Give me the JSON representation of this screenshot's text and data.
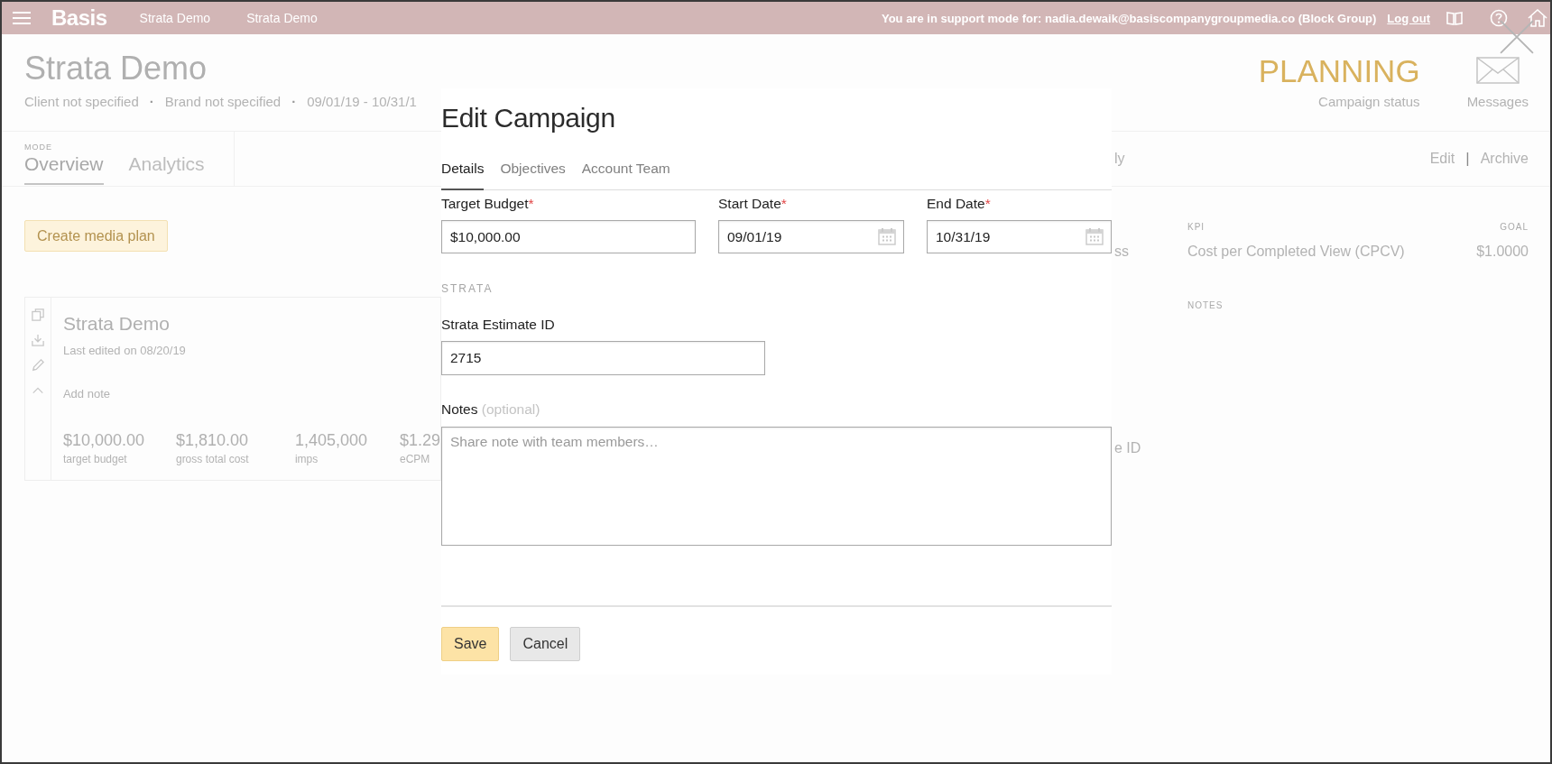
{
  "top_bar": {
    "logo": "Basis",
    "breadcrumbs": [
      "Strata Demo",
      "Strata Demo"
    ],
    "support_notice": "You are in support mode for: nadia.dewaik@basiscompanygroupmedia.co (Block Group)",
    "logout": "Log out"
  },
  "header": {
    "title": "Strata Demo",
    "meta": [
      {
        "kind": "text",
        "text": "Client not specified"
      },
      {
        "kind": "separator",
        "text": "·"
      },
      {
        "kind": "text",
        "text": "Brand not specified"
      },
      {
        "kind": "separator",
        "text": "·"
      },
      {
        "kind": "text",
        "text": "09/01/19 - 10/31/1"
      }
    ],
    "status": {
      "value": "PLANNING",
      "label": "Campaign status"
    },
    "messages": {
      "label": "Messages"
    }
  },
  "tab_bar": {
    "mode_label": "MODE",
    "tabs": [
      {
        "label": "Overview",
        "selected": true
      },
      {
        "label": "Analytics",
        "selected": false
      }
    ],
    "cut_text": "ly",
    "actions": [
      {
        "kind": "link",
        "text": "Edit"
      },
      {
        "kind": "separator",
        "text": "|"
      },
      {
        "kind": "link",
        "text": "Archive"
      }
    ]
  },
  "overview": {
    "create_button": "Create media plan",
    "plan_card": {
      "title": "Strata Demo",
      "edited": "Last edited on 08/20/19",
      "add_note": "Add note",
      "stats": [
        {
          "value": "$10,000.00",
          "label": "target budget"
        },
        {
          "value": "$1,810.00",
          "label": "gross total cost"
        },
        {
          "value": "1,405,000",
          "label": "imps"
        },
        {
          "value": "$1.29",
          "label": "eCPM"
        }
      ]
    }
  },
  "kpi_panel": {
    "cut_texts": [
      "ss",
      "e ID"
    ],
    "columns": [
      "KPI",
      "GOAL"
    ],
    "rows": [
      {
        "kpi": "Cost per Completed View (CPCV)",
        "goal": "$1.0000"
      }
    ],
    "notes_heading": "NOTES"
  },
  "modal": {
    "title": "Edit Campaign",
    "tabs": [
      {
        "label": "Details",
        "selected": true
      },
      {
        "label": "Objectives",
        "selected": false
      },
      {
        "label": "Account Team",
        "selected": false
      }
    ],
    "fields": [
      {
        "kind": "text",
        "label": "Target Budget",
        "required_mark": "*",
        "value": "$10,000.00"
      },
      {
        "kind": "date",
        "label": "Start Date",
        "required_mark": "*",
        "value": "09/01/19"
      },
      {
        "kind": "date",
        "label": "End Date",
        "required_mark": "*",
        "value": "10/31/19"
      }
    ],
    "section": "STRATA",
    "estimate_field": {
      "label": "Strata Estimate ID",
      "value": "2715"
    },
    "notes": {
      "label": "Notes",
      "hint": "(optional)",
      "placeholder": "Share note with team members…"
    },
    "buttons": [
      {
        "kind": "primary",
        "label": "Save"
      },
      {
        "kind": "secondary",
        "label": "Cancel"
      }
    ]
  }
}
